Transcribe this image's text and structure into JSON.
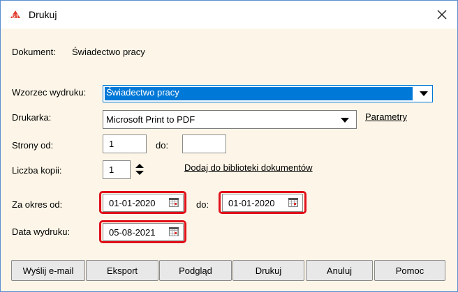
{
  "window": {
    "title": "Drukuj",
    "app_icon": "gt-logo-icon",
    "close_icon": "close-icon"
  },
  "document": {
    "label": "Dokument:",
    "value": "Świadectwo pracy"
  },
  "template": {
    "label": "Wzorzec wydruku:",
    "value": "Świadectwo pracy"
  },
  "printer": {
    "label": "Drukarka:",
    "value": "Microsoft Print to PDF",
    "params_link": "Parametry"
  },
  "pages": {
    "label_from": "Strony od:",
    "value_from": "1",
    "label_to": "do:",
    "value_to": ""
  },
  "copies": {
    "label": "Liczba kopii:",
    "value": "1",
    "library_link": "Dodaj do biblioteki dokumentów"
  },
  "period": {
    "label_from": "Za okres od:",
    "value_from": "01-01-2020",
    "label_to": "do:",
    "value_to": "01-01-2020"
  },
  "print_date": {
    "label": "Data wydruku:",
    "value": "05-08-2021"
  },
  "buttons": {
    "email": "Wyślij e-mail",
    "export": "Eksport",
    "preview": "Podgląd",
    "print": "Drukuj",
    "cancel": "Anuluj",
    "help": "Pomoc"
  },
  "colors": {
    "highlight": "#e0101a",
    "selection": "#0078d7",
    "background": "#fdf6e8"
  }
}
